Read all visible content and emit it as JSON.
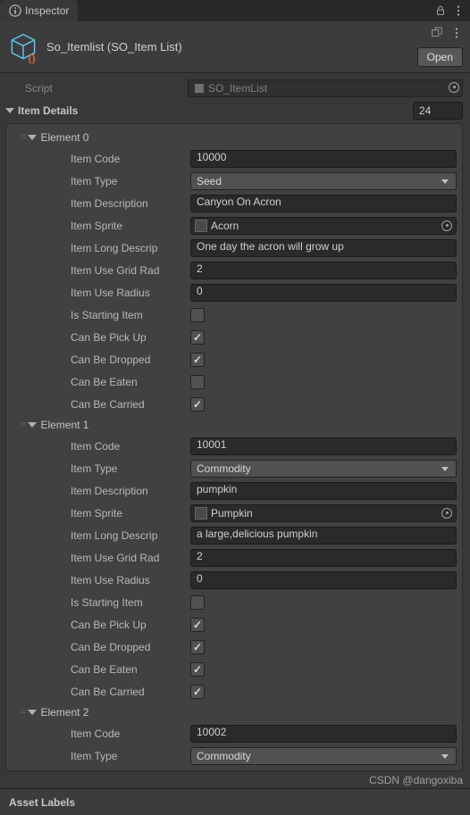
{
  "tab": {
    "title": "Inspector"
  },
  "header": {
    "title": "So_Itemlist (SO_Item List)",
    "open_label": "Open"
  },
  "script": {
    "label": "Script",
    "value": "SO_ItemList"
  },
  "itemDetails": {
    "label": "Item Details",
    "count": "24"
  },
  "labels": {
    "itemCode": "Item Code",
    "itemType": "Item Type",
    "itemDescription": "Item Description",
    "itemSprite": "Item Sprite",
    "itemLongDescription": "Item Long Descrip",
    "itemUseGridRadius": "Item Use Grid Rad",
    "itemUseRadius": "Item Use Radius",
    "isStartingItem": "Is Starting Item",
    "canBePickUp": "Can Be Pick Up",
    "canBeDropped": "Can Be Dropped",
    "canBeEaten": "Can Be Eaten",
    "canBeCarried": "Can Be Carried"
  },
  "elements": [
    {
      "header": "Element 0",
      "itemCode": "10000",
      "itemType": "Seed",
      "itemDescription": "Canyon On Acron",
      "itemSprite": "Acorn",
      "itemLongDescription": "One day the acron will grow up",
      "itemUseGridRadius": "2",
      "itemUseRadius": "0",
      "isStartingItem": false,
      "canBePickUp": true,
      "canBeDropped": true,
      "canBeEaten": false,
      "canBeCarried": true
    },
    {
      "header": "Element 1",
      "itemCode": "10001",
      "itemType": "Commodity",
      "itemDescription": "pumpkin",
      "itemSprite": "Pumpkin",
      "itemLongDescription": "a large,delicious pumpkin",
      "itemUseGridRadius": "2",
      "itemUseRadius": "0",
      "isStartingItem": false,
      "canBePickUp": true,
      "canBeDropped": true,
      "canBeEaten": true,
      "canBeCarried": true
    },
    {
      "header": "Element 2",
      "itemCode": "10002",
      "itemType": "Commodity"
    }
  ],
  "footer": {
    "label": "Asset Labels"
  },
  "watermark": "CSDN @dangoxiba"
}
